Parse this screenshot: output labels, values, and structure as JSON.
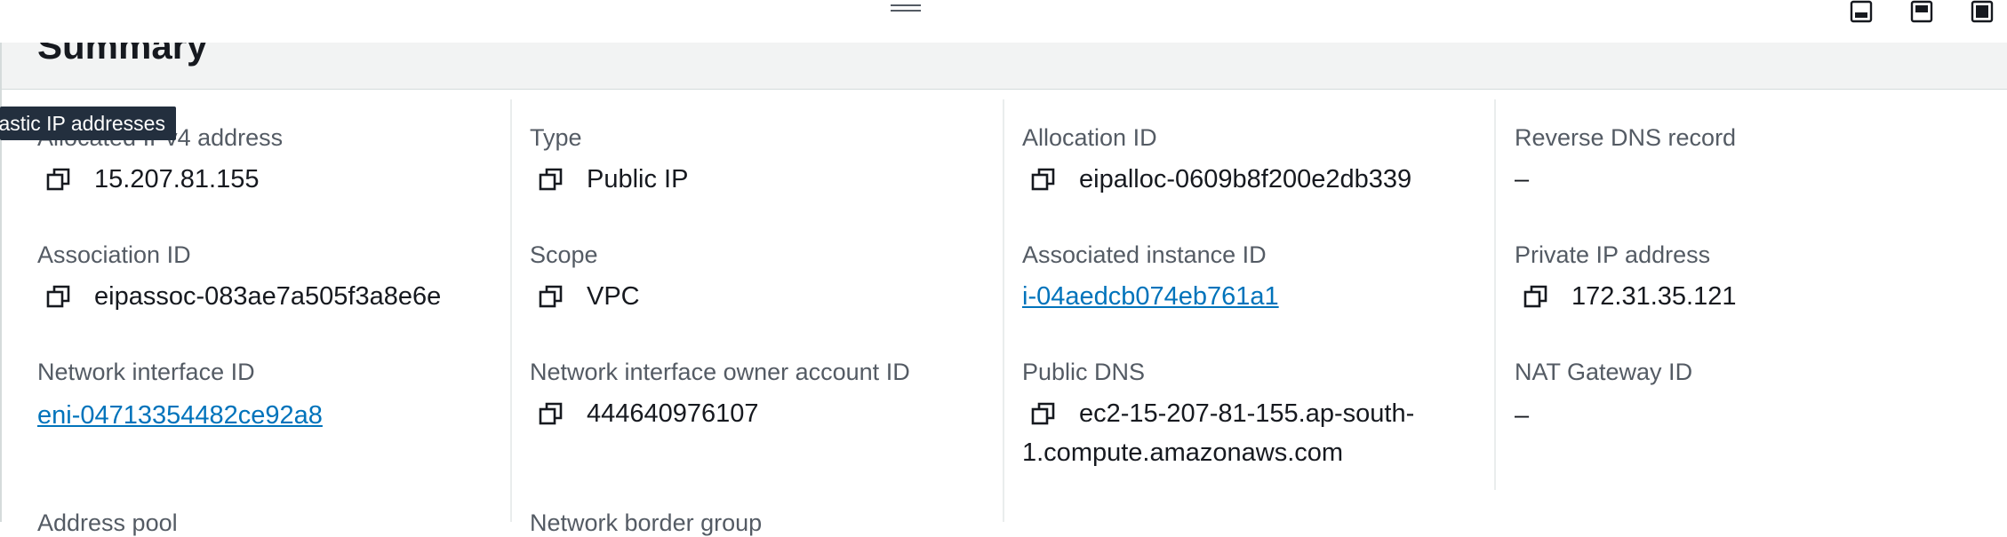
{
  "panel": {
    "title": "Summary"
  },
  "tooltip": {
    "text": "Elastic IP addresses"
  },
  "fields": {
    "allocated_ipv4": {
      "label": "Allocated IPv4 address",
      "value": "15.207.81.155"
    },
    "type": {
      "label": "Type",
      "value": "Public IP"
    },
    "allocation_id": {
      "label": "Allocation ID",
      "value": "eipalloc-0609b8f200e2db339"
    },
    "reverse_dns": {
      "label": "Reverse DNS record",
      "value": "–"
    },
    "association_id": {
      "label": "Association ID",
      "value": "eipassoc-083ae7a505f3a8e6e"
    },
    "scope": {
      "label": "Scope",
      "value": "VPC"
    },
    "instance_id": {
      "label": "Associated instance ID",
      "value": "i-04aedcb074eb761a1"
    },
    "private_ip": {
      "label": "Private IP address",
      "value": "172.31.35.121"
    },
    "eni": {
      "label": "Network interface ID",
      "value": "eni-04713354482ce92a8"
    },
    "eni_owner": {
      "label": "Network interface owner account ID",
      "value": "444640976107"
    },
    "public_dns": {
      "label": "Public DNS",
      "value_line1": "ec2-15-207-81-155.ap-south-",
      "value_line2": "1.compute.amazonaws.com"
    },
    "nat_gateway": {
      "label": "NAT Gateway ID",
      "value": "–"
    },
    "address_pool": {
      "label": "Address pool"
    },
    "network_border": {
      "label": "Network border group"
    }
  }
}
